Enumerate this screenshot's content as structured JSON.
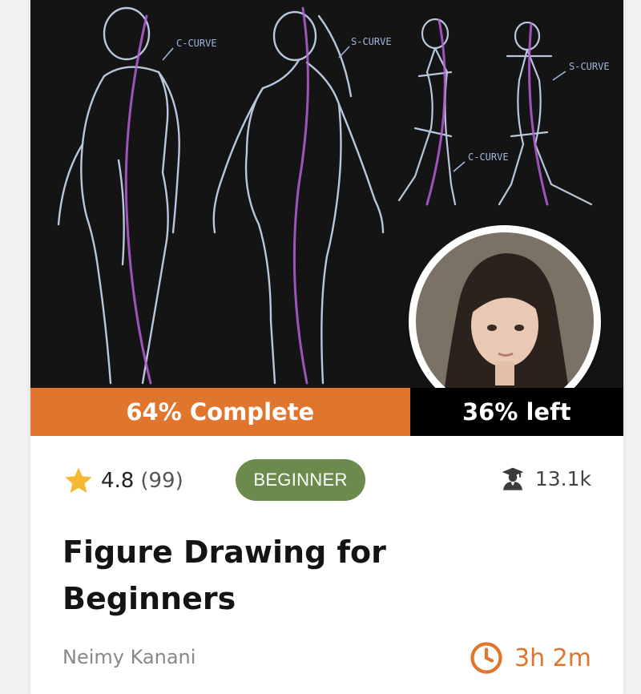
{
  "course": {
    "progress": {
      "percent_complete": 64,
      "complete_label": "64% Complete",
      "left_label": "36% left"
    },
    "hero_annotations": [
      "C-CURVE",
      "S-CURVE",
      "S-CURVE",
      "C-CURVE"
    ],
    "rating": {
      "value": "4.8",
      "count": "(99)"
    },
    "level": "BEGINNER",
    "students": "13.1k",
    "title": "Figure Drawing for Beginners",
    "author": "Neimy Kanani",
    "duration": "3h 2m",
    "icons": {
      "rating": "star-icon",
      "students": "student-graduate-icon",
      "duration": "clock-icon"
    },
    "colors": {
      "accent": "#e0762e",
      "level_badge": "#6b8a4c",
      "star": "#f5b82e",
      "hero_background": "#141414"
    }
  }
}
